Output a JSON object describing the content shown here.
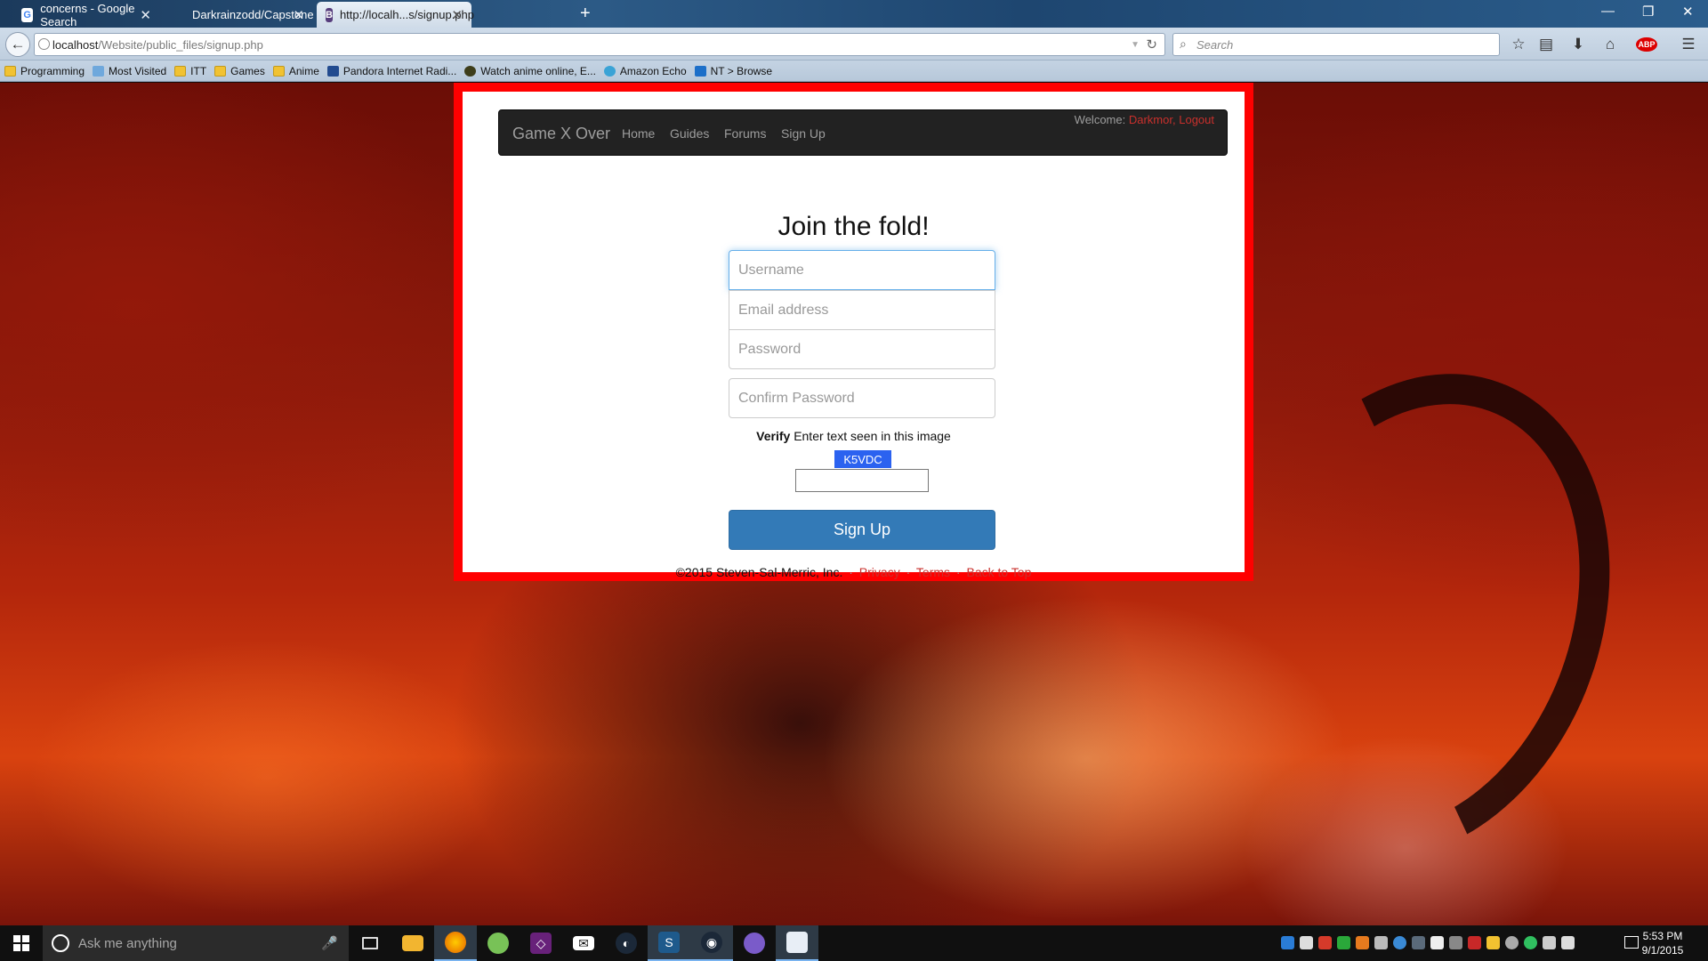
{
  "browser": {
    "tabs": [
      {
        "title": "concerns - Google Search",
        "favicon": "google-icon",
        "active": false
      },
      {
        "title": "Darkrainzodd/Capstone",
        "favicon": "github-icon",
        "active": false
      },
      {
        "title": "http://localh...s/signup.php",
        "favicon": "bootstrap-icon",
        "active": true
      }
    ],
    "new_tab": "+",
    "url_host": "localhost",
    "url_path": "/Website/public_files/signup.php",
    "search_placeholder": "Search",
    "bookmarks": [
      {
        "label": "Programming",
        "icon": "folder-icon"
      },
      {
        "label": "Most Visited",
        "icon": "most-visited-icon"
      },
      {
        "label": "ITT",
        "icon": "folder-icon"
      },
      {
        "label": "Games",
        "icon": "folder-icon"
      },
      {
        "label": "Anime",
        "icon": "folder-icon"
      },
      {
        "label": "Pandora Internet Radi...",
        "icon": "pandora-icon"
      },
      {
        "label": "Watch anime online, E...",
        "icon": "anime-site-icon"
      },
      {
        "label": "Amazon Echo",
        "icon": "echo-icon"
      },
      {
        "label": "NT > Browse",
        "icon": "nt-icon"
      }
    ]
  },
  "site": {
    "brand": "Game X Over",
    "nav": [
      "Home",
      "Guides",
      "Forums",
      "Sign Up"
    ],
    "welcome_label": "Welcome:",
    "welcome_user": "Darkmor",
    "logout": "Logout",
    "heading": "Join the fold!",
    "form": {
      "username_placeholder": "Username",
      "email_placeholder": "Email address",
      "password_placeholder": "Password",
      "confirm_placeholder": "Confirm Password",
      "verify_bold": "Verify",
      "verify_text": "Enter text seen in this image",
      "captcha_code": "K5VDC",
      "submit_label": "Sign Up"
    },
    "footer": {
      "copyright": "©2015 Steven-Sal-Merric, Inc.",
      "links": [
        "Privacy",
        "Terms",
        "Back to Top"
      ]
    }
  },
  "taskbar": {
    "search_placeholder": "Ask me anything",
    "apps": [
      "task-view-icon",
      "file-explorer-icon",
      "firefox-icon",
      "android-studio-icon",
      "visual-studio-icon",
      "mail-icon",
      "steam-alt-icon",
      "game-icon",
      "steam-icon",
      "app-icon",
      "notepad-icon"
    ],
    "time": "5:53 PM",
    "date": "9/1/2015"
  },
  "colors": {
    "frame_red": "#ff0000",
    "navbar": "#222222",
    "primary_button": "#337ab7",
    "link_red": "#c9302c",
    "captcha_bg": "#2b62f0"
  }
}
